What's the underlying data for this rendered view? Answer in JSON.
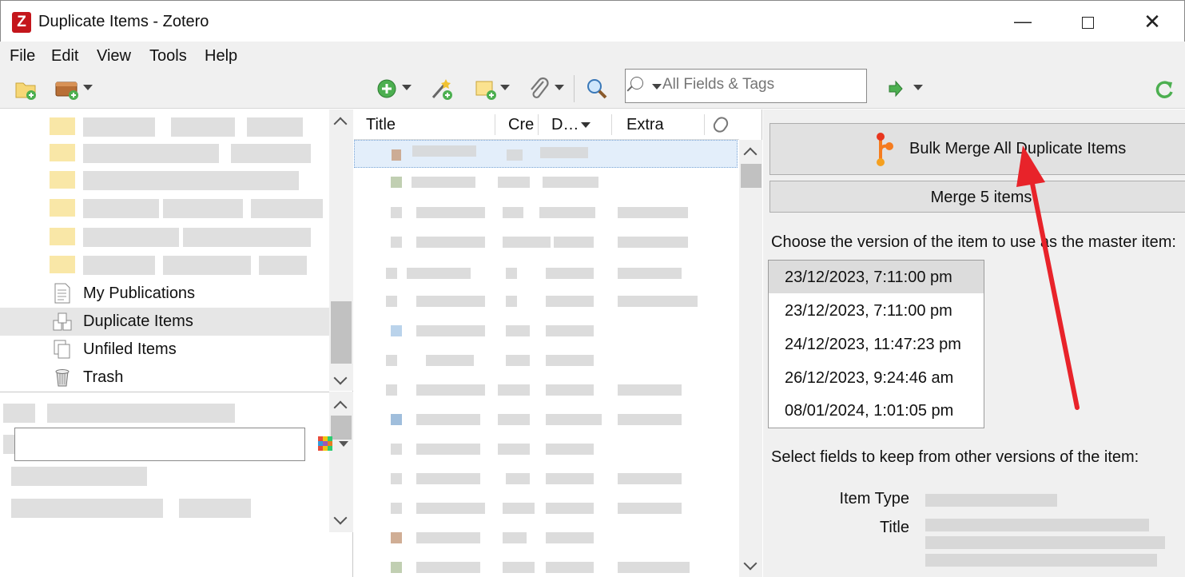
{
  "window": {
    "title": "Duplicate Items - Zotero",
    "app_icon_letter": "Z"
  },
  "menu": [
    {
      "label": "File"
    },
    {
      "label": "Edit"
    },
    {
      "label": "View"
    },
    {
      "label": "Tools"
    },
    {
      "label": "Help"
    }
  ],
  "toolbar": {
    "search": {
      "placeholder": "All Fields & Tags",
      "value": ""
    }
  },
  "collections": {
    "items": [
      {
        "label": "My Publications",
        "icon": "document-icon"
      },
      {
        "label": "Duplicate Items",
        "icon": "duplicate-icon",
        "selected": true
      },
      {
        "label": "Unfiled Items",
        "icon": "unfiled-icon"
      },
      {
        "label": "Trash",
        "icon": "trash-icon"
      }
    ]
  },
  "items_table": {
    "columns": [
      "Title",
      "Cre",
      "D…",
      "Extra"
    ]
  },
  "merge_pane": {
    "bulk_merge_label": "Bulk Merge All Duplicate Items",
    "merge_label": "Merge 5 items",
    "choose_label": "Choose the version of the item to use as the master item:",
    "versions": [
      "23/12/2023, 7:11:00 pm",
      "23/12/2023, 7:11:00 pm",
      "24/12/2023, 11:47:23 pm",
      "26/12/2023, 9:24:46 am",
      "08/01/2024, 1:01:05 pm"
    ],
    "select_fields_label": "Select fields to keep from other versions of the item:",
    "fields": [
      {
        "label": "Item Type"
      },
      {
        "label": "Title"
      }
    ]
  },
  "colors": {
    "accent_arrow": "#e8232a",
    "merge_icon": "#f57c1f",
    "selection": "#e3eefa"
  }
}
